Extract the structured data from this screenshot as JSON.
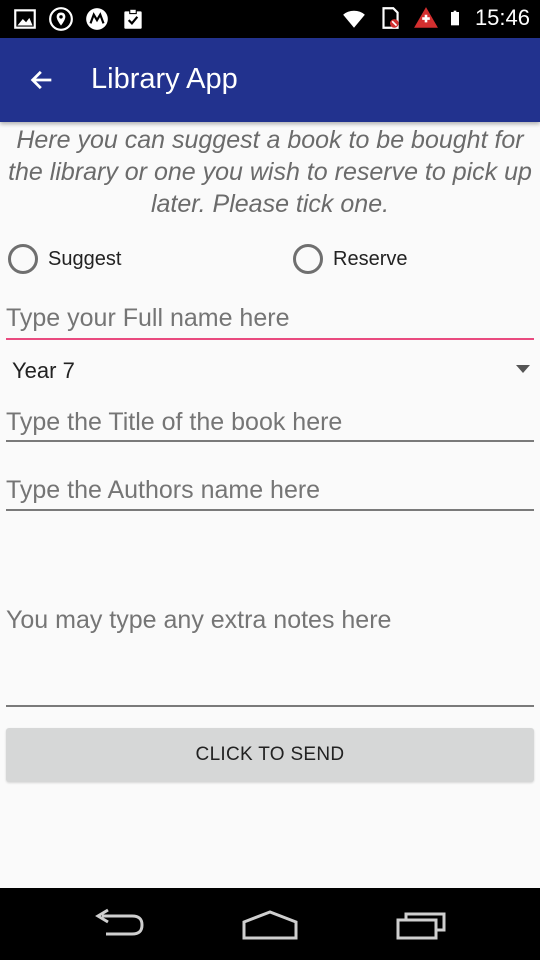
{
  "status_bar": {
    "time": "15:46",
    "left_icons": [
      "image-icon",
      "location-icon",
      "motorola-icon",
      "clipboard-check-icon"
    ],
    "right_icons": [
      "wifi-icon",
      "no-sim-icon",
      "alert-icon",
      "battery-icon"
    ]
  },
  "app_bar": {
    "title": "Library App",
    "back_icon": "arrow-back-icon",
    "color": "#22328e"
  },
  "intro_text": "Here you can suggest a book to be bought for the library or one you wish to reserve to pick up later. Please tick one.",
  "radio_options": [
    {
      "label": "Suggest",
      "checked": false
    },
    {
      "label": "Reserve",
      "checked": false
    }
  ],
  "form": {
    "full_name": {
      "placeholder": "Type your Full name here",
      "value": ""
    },
    "year": {
      "selected": "Year 7"
    },
    "book_title": {
      "placeholder": "Type the Title of the book here",
      "value": ""
    },
    "authors": {
      "placeholder": "Type the Authors name here",
      "value": ""
    },
    "notes": {
      "placeholder": "You may type any extra notes here",
      "value": ""
    },
    "submit_label": "CLICK TO SEND"
  },
  "accent_color": "#e94a7f",
  "nav_bar": {
    "icons": [
      "nav-back-icon",
      "nav-home-icon",
      "nav-recents-icon"
    ]
  }
}
